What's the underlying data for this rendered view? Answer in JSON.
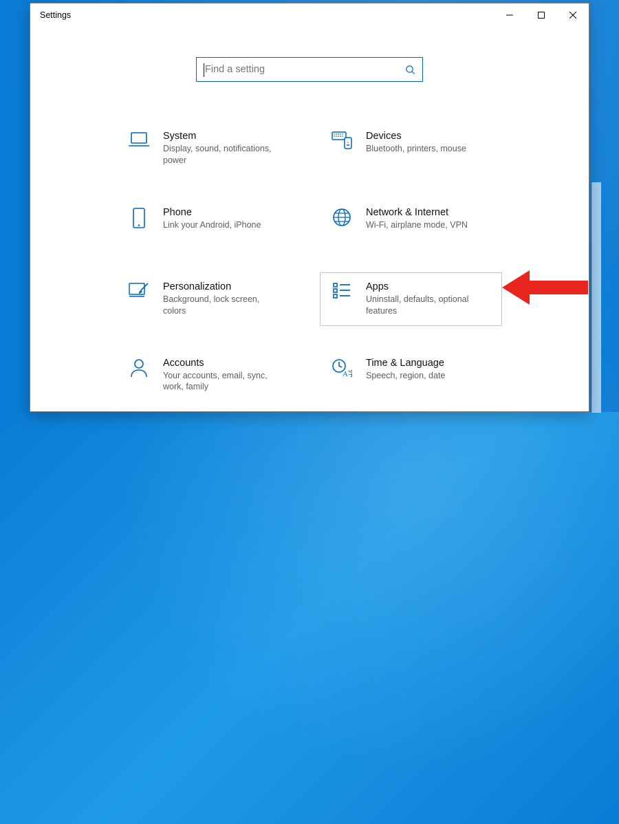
{
  "window": {
    "title": "Settings"
  },
  "search": {
    "placeholder": "Find a setting"
  },
  "categories": [
    {
      "id": "system",
      "title": "System",
      "sub": "Display, sound, notifications, power",
      "icon": "laptop-icon"
    },
    {
      "id": "devices",
      "title": "Devices",
      "sub": "Bluetooth, printers, mouse",
      "icon": "devices-icon"
    },
    {
      "id": "phone",
      "title": "Phone",
      "sub": "Link your Android, iPhone",
      "icon": "phone-icon"
    },
    {
      "id": "network",
      "title": "Network & Internet",
      "sub": "Wi-Fi, airplane mode, VPN",
      "icon": "globe-icon"
    },
    {
      "id": "personal",
      "title": "Personalization",
      "sub": "Background, lock screen, colors",
      "icon": "paintbrush-icon"
    },
    {
      "id": "apps",
      "title": "Apps",
      "sub": "Uninstall, defaults, optional features",
      "icon": "apps-list-icon",
      "highlight": true
    },
    {
      "id": "accounts",
      "title": "Accounts",
      "sub": "Your accounts, email, sync, work, family",
      "icon": "person-icon"
    },
    {
      "id": "time",
      "title": "Time & Language",
      "sub": "Speech, region, date",
      "icon": "time-language-icon"
    }
  ],
  "colors": {
    "accent": "#0067c0",
    "annotation": "#e8261e"
  }
}
